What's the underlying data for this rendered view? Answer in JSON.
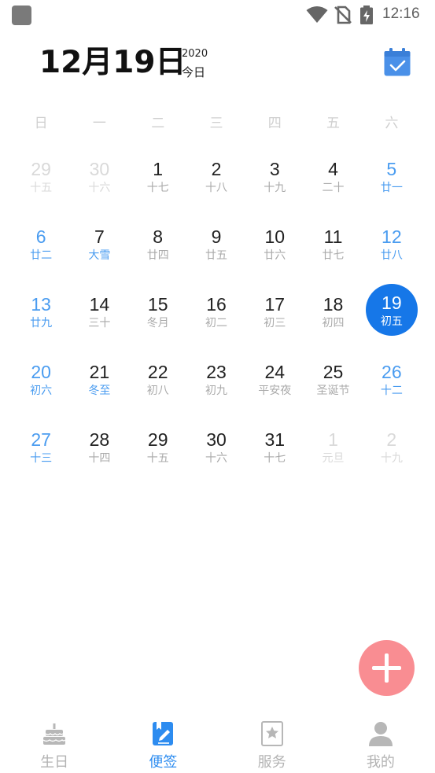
{
  "status_bar": {
    "time": "12:16",
    "icons": [
      "app-icon",
      "wifi-icon",
      "no-sim-icon",
      "battery-charging-icon"
    ]
  },
  "header": {
    "date": "12月19日",
    "year": "2020",
    "today": "今日",
    "calendar_icon": "calendar-check-icon"
  },
  "weekdays": [
    "日",
    "一",
    "二",
    "三",
    "四",
    "五",
    "六"
  ],
  "weeks": [
    [
      {
        "num": "29",
        "lunar": "十五",
        "type": "other"
      },
      {
        "num": "30",
        "lunar": "十六",
        "type": "other"
      },
      {
        "num": "1",
        "lunar": "十七",
        "type": ""
      },
      {
        "num": "2",
        "lunar": "十八",
        "type": ""
      },
      {
        "num": "3",
        "lunar": "十九",
        "type": ""
      },
      {
        "num": "4",
        "lunar": "二十",
        "type": ""
      },
      {
        "num": "5",
        "lunar": "廿一",
        "type": "weekend"
      }
    ],
    [
      {
        "num": "6",
        "lunar": "廿二",
        "type": "weekend"
      },
      {
        "num": "7",
        "lunar": "大雪",
        "type": "festival"
      },
      {
        "num": "8",
        "lunar": "廿四",
        "type": ""
      },
      {
        "num": "9",
        "lunar": "廿五",
        "type": ""
      },
      {
        "num": "10",
        "lunar": "廿六",
        "type": ""
      },
      {
        "num": "11",
        "lunar": "廿七",
        "type": ""
      },
      {
        "num": "12",
        "lunar": "廿八",
        "type": "weekend"
      }
    ],
    [
      {
        "num": "13",
        "lunar": "廿九",
        "type": "weekend"
      },
      {
        "num": "14",
        "lunar": "三十",
        "type": ""
      },
      {
        "num": "15",
        "lunar": "冬月",
        "type": ""
      },
      {
        "num": "16",
        "lunar": "初二",
        "type": ""
      },
      {
        "num": "17",
        "lunar": "初三",
        "type": ""
      },
      {
        "num": "18",
        "lunar": "初四",
        "type": ""
      },
      {
        "num": "19",
        "lunar": "初五",
        "type": "selected"
      }
    ],
    [
      {
        "num": "20",
        "lunar": "初六",
        "type": "weekend"
      },
      {
        "num": "21",
        "lunar": "冬至",
        "type": "festival"
      },
      {
        "num": "22",
        "lunar": "初八",
        "type": ""
      },
      {
        "num": "23",
        "lunar": "初九",
        "type": ""
      },
      {
        "num": "24",
        "lunar": "平安夜",
        "type": ""
      },
      {
        "num": "25",
        "lunar": "圣诞节",
        "type": ""
      },
      {
        "num": "26",
        "lunar": "十二",
        "type": "weekend"
      }
    ],
    [
      {
        "num": "27",
        "lunar": "十三",
        "type": "weekend"
      },
      {
        "num": "28",
        "lunar": "十四",
        "type": ""
      },
      {
        "num": "29",
        "lunar": "十五",
        "type": ""
      },
      {
        "num": "30",
        "lunar": "十六",
        "type": ""
      },
      {
        "num": "31",
        "lunar": "十七",
        "type": ""
      },
      {
        "num": "1",
        "lunar": "元旦",
        "type": "other"
      },
      {
        "num": "2",
        "lunar": "十九",
        "type": "other"
      }
    ]
  ],
  "fab": {
    "icon": "plus-icon"
  },
  "nav": [
    {
      "label": "生日",
      "icon": "birthday-cake-icon",
      "active": false
    },
    {
      "label": "便签",
      "icon": "note-edit-icon",
      "active": true
    },
    {
      "label": "服务",
      "icon": "star-card-icon",
      "active": false
    },
    {
      "label": "我的",
      "icon": "person-icon",
      "active": false
    }
  ],
  "colors": {
    "accent": "#1677e8",
    "weekend": "#4a9cf0",
    "fab": "#f98d92",
    "nav_active": "#2d8cf0",
    "nav_inactive": "#b3b3b3"
  }
}
